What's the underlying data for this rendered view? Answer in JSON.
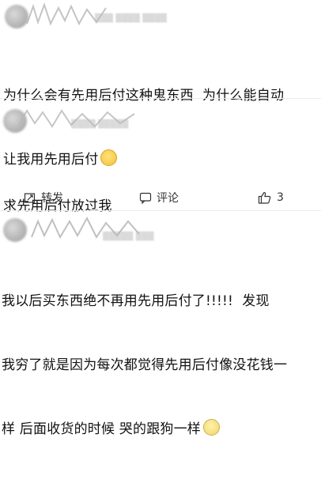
{
  "posts": [
    {
      "id": "post-1",
      "text_lines": [
        "为什么会有先用后付这种鬼东西  为什么能自动",
        "让我用先用后付"
      ],
      "emoji": "smile-icon"
    },
    {
      "id": "post-2",
      "text_lines": [
        "求先用后付放过我"
      ]
    },
    {
      "id": "post-3",
      "text_lines": [
        "我以后买东西绝不再用先用后付了!!!!!  发现",
        "我穷了就是因为每次都觉得先用后付像没花钱一",
        "样 后面收货的时候 哭的跟狗一样"
      ],
      "emoji": "crying-icon"
    }
  ],
  "actions": {
    "repost_label": "转发",
    "comment_label": "评论",
    "like_count": "3"
  },
  "colors": {
    "text": "#111111",
    "muted": "#b8b8b8",
    "divider": "#ececec"
  }
}
